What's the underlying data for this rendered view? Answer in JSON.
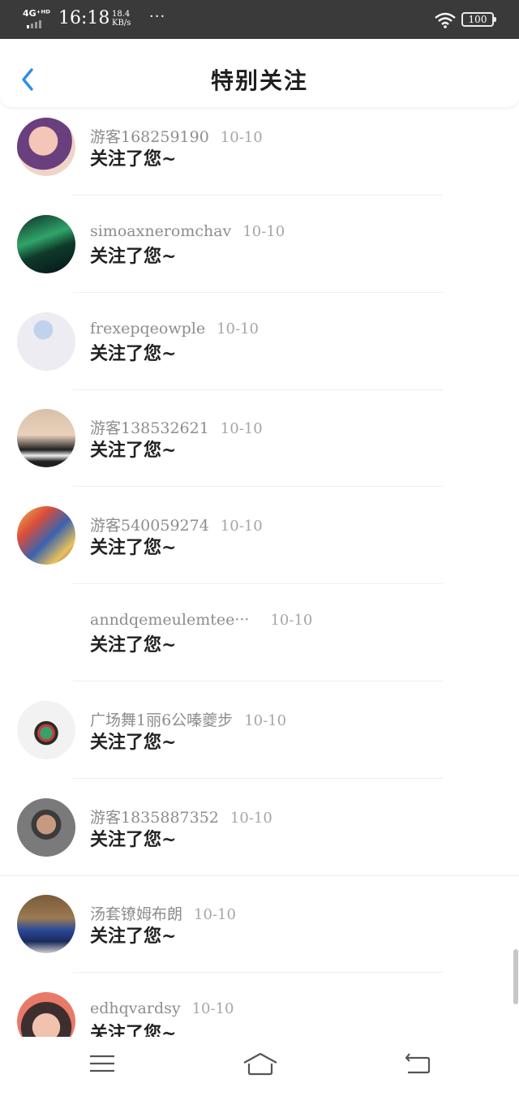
{
  "status_bar": {
    "network": "4G⁺ᴴᴰ",
    "time": "16:18",
    "speed_value": "18.4",
    "speed_unit": "KB/s",
    "dots": "···",
    "battery": "100"
  },
  "header": {
    "title": "特别关注",
    "back_icon": "chevron-left-icon",
    "accent": "#2f8fe0"
  },
  "notifications": [
    {
      "name": "游客168259190",
      "date": "10-10",
      "message": "关注了您~",
      "avatar_colors": [
        "#5a3b6e",
        "#f0b6a6"
      ]
    },
    {
      "name": "simoaxneromchav",
      "date": "10-10",
      "message": "关注了您~",
      "avatar_colors": [
        "#1a3a2a",
        "#3db36a"
      ]
    },
    {
      "name": "frexepqeowple",
      "date": "10-10",
      "message": "关注了您~",
      "avatar_colors": [
        "#e8e8ee",
        "#a9c2e3"
      ]
    },
    {
      "name": "游客138532621",
      "date": "10-10",
      "message": "关注了您~",
      "avatar_colors": [
        "#d9c2a9",
        "#2a2a2a"
      ]
    },
    {
      "name": "游客540059274",
      "date": "10-10",
      "message": "关注了您~",
      "avatar_colors": [
        "#e3a243",
        "#3a5ea8"
      ]
    },
    {
      "name": "anndqemeulemtee···",
      "date": "10-10",
      "message": "关注了您~",
      "avatar_colors": [
        "#ffffff",
        "#ffffff"
      ]
    },
    {
      "name": "广场舞1丽6公嗪夔步",
      "date": "10-10",
      "message": "关注了您~",
      "avatar_colors": [
        "#eeeeee",
        "#3a9a6a"
      ]
    },
    {
      "name": "游客1835887352",
      "date": "10-10",
      "message": "关注了您~",
      "avatar_colors": [
        "#6a6a6a",
        "#c29a82"
      ]
    },
    {
      "name": "汤套镣姆布朗",
      "date": "10-10",
      "message": "关注了您~",
      "avatar_colors": [
        "#7a5a3a",
        "#2a4a9a"
      ]
    },
    {
      "name": "edhqvardsy",
      "date": "10-10",
      "message": "关注了您~",
      "avatar_colors": [
        "#f3c7b5",
        "#4a3a3a"
      ]
    }
  ],
  "nav_bar": {
    "menu_icon": "menu-icon",
    "home_icon": "home-icon",
    "back_icon": "back-arrow-icon"
  }
}
